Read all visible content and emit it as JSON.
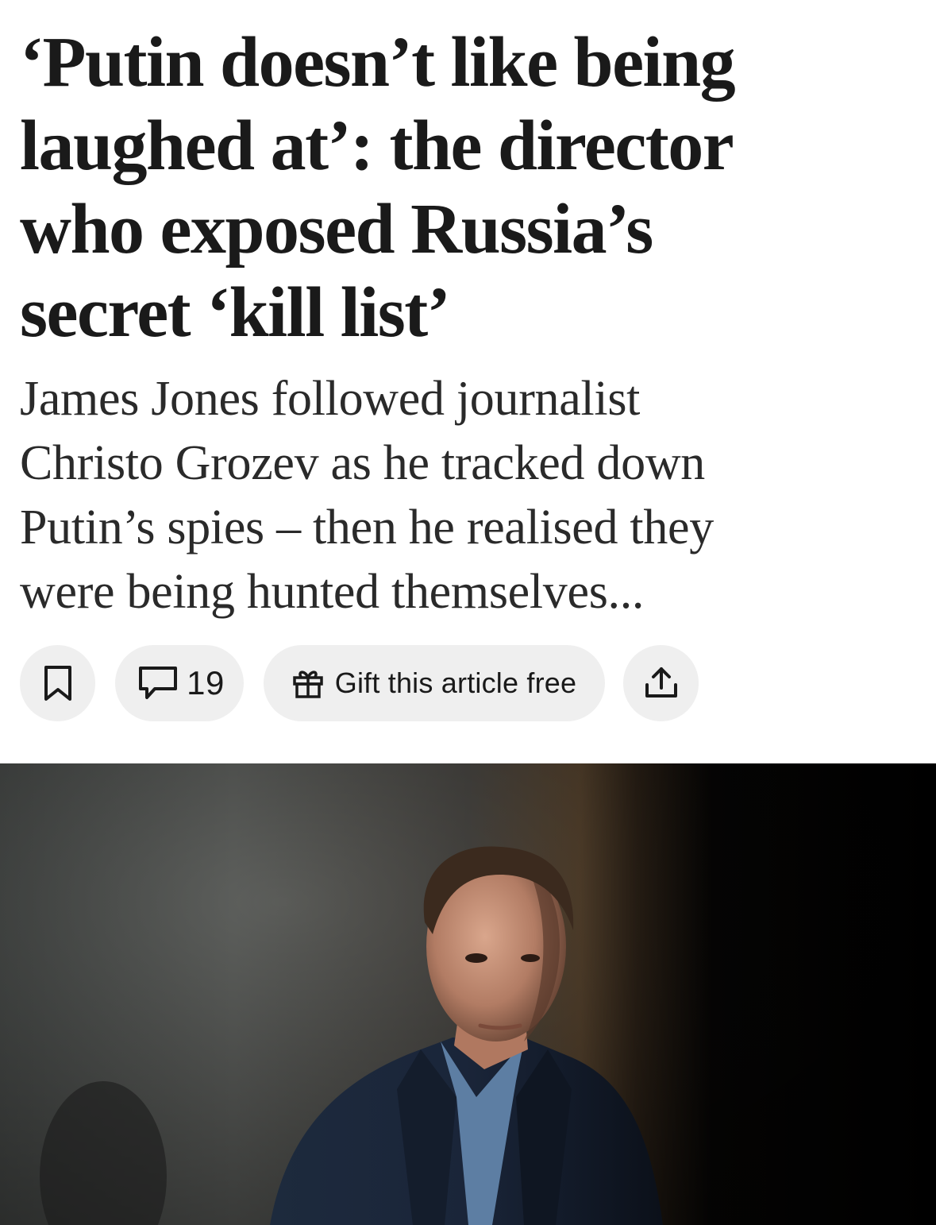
{
  "article": {
    "headline_lines": [
      "‘Putin doesn’t like being",
      "laughed at’: the director",
      "who exposed Russia’s",
      "secret ‘kill list’"
    ],
    "standfirst_lines": [
      "James Jones followed journalist",
      "Christo Grozev as he tracked down",
      "Putin’s spies – then he realised they",
      "were being hunted themselves..."
    ]
  },
  "actions": {
    "bookmark_icon": "bookmark-icon",
    "comment_icon": "comment-icon",
    "comment_count": "19",
    "gift_icon": "gift-icon",
    "gift_label": "Gift this article free",
    "share_icon": "share-icon"
  },
  "colors": {
    "text": "#1a1a1a",
    "pill_background": "#efefef"
  }
}
